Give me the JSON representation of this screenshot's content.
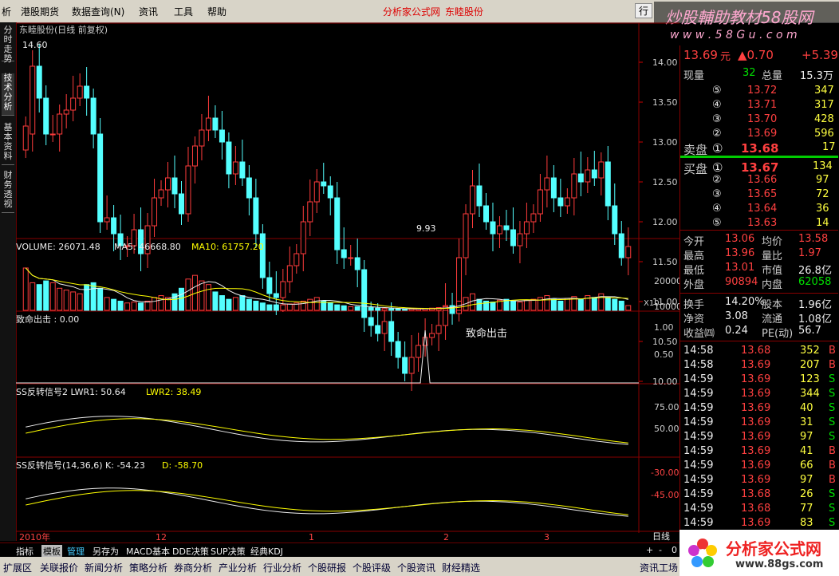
{
  "menu": {
    "items": [
      "析",
      "港股期货",
      "数据查询(N)",
      "资讯",
      "工具",
      "帮助"
    ],
    "center_links": [
      "分析家公式网",
      "东睦股份"
    ],
    "right_btn": "行"
  },
  "watermark": {
    "title": "炒股輔助教材58股网",
    "url": "w w w . 5 8 G u . c o m"
  },
  "vtabs": [
    "分时走势",
    "技术分析",
    "基本资料",
    "财务透视"
  ],
  "chart": {
    "title": "东睦股份(日线 前复权)",
    "price_ticks": [
      "14.00",
      "13.50",
      "13.00",
      "12.50",
      "12.00",
      "11.50",
      "11.00",
      "10.50",
      "10.00"
    ],
    "high_label": "14.60",
    "low_label": "9.93",
    "volume": {
      "label": "VOLUME: 26071.48",
      "ma5": "MA5: 46668.80",
      "ma10": "MA10: 61757.20",
      "ticks": [
        "20000",
        "10000"
      ],
      "unit": "X10"
    },
    "fatal": {
      "label": "致命出击 : 0.00",
      "ticks": [
        "1.00",
        "0.50"
      ],
      "marker": "致命出击"
    },
    "ss2": {
      "label": "SS反转信号2  LWR1: 50.64",
      "lwr2": "LWR2: 38.49",
      "ticks": [
        "75.00",
        "50.00"
      ]
    },
    "ss": {
      "label": "SS反转信号(14,36,6)  K: -54.23",
      "d": "D: -58.70",
      "ticks": [
        "-30.00",
        "-45.00"
      ]
    },
    "xaxis": [
      "2010年",
      "12",
      "1",
      "2",
      "3"
    ],
    "period": "日线"
  },
  "chart_data": {
    "type": "candlestick",
    "title": "东睦股份(日线 前复权)",
    "high": 14.6,
    "low": 9.93,
    "close": [
      13.2,
      13.95,
      13.55,
      13.1,
      13.1,
      13.35,
      13.4,
      13.55,
      13.7,
      13.55,
      13.1,
      12.0,
      12.05,
      11.85,
      11.7,
      11.7,
      11.9,
      11.6,
      11.95,
      12.3,
      12.4,
      12.55,
      12.35,
      12.1,
      12.7,
      12.95,
      13.15,
      13.3,
      13.15,
      13.0,
      12.6,
      12.75,
      12.55,
      12.3,
      11.85,
      11.3,
      11.1,
      11.05,
      11.25,
      11.45,
      11.6,
      12.0,
      12.25,
      12.5,
      12.45,
      12.3,
      11.65,
      11.55,
      11.55,
      11.4,
      10.8,
      10.7,
      10.6,
      10.75,
      10.5,
      10.3,
      10.1,
      10.3,
      10.45,
      10.55,
      10.6,
      10.7,
      10.95,
      10.85,
      11.55,
      12.1,
      12.45,
      12.2,
      12.0,
      11.85,
      11.95,
      11.9,
      11.7,
      11.85,
      12.0,
      12.1,
      12.4,
      12.55,
      12.3,
      12.2,
      12.3,
      12.6,
      12.5,
      12.65,
      12.55,
      12.75,
      12.2,
      11.85,
      11.55,
      11.69
    ],
    "open": [
      12.9,
      13.1,
      13.95,
      13.55,
      13.1,
      13.1,
      13.35,
      13.4,
      13.55,
      13.7,
      13.55,
      13.1,
      12.0,
      12.05,
      11.85,
      11.7,
      11.7,
      11.9,
      11.6,
      11.95,
      12.3,
      12.4,
      12.55,
      12.35,
      12.1,
      12.7,
      12.95,
      13.15,
      13.3,
      13.15,
      13.0,
      12.6,
      12.75,
      12.55,
      12.3,
      11.85,
      11.3,
      11.1,
      11.05,
      11.25,
      11.45,
      11.6,
      12.0,
      12.25,
      12.5,
      12.45,
      12.3,
      11.65,
      11.55,
      11.55,
      11.4,
      10.8,
      10.7,
      10.6,
      10.75,
      10.5,
      10.3,
      10.1,
      10.3,
      10.45,
      10.55,
      10.6,
      10.7,
      10.95,
      10.85,
      11.55,
      12.1,
      12.45,
      12.2,
      12.0,
      11.85,
      11.95,
      11.9,
      11.7,
      11.85,
      12.0,
      12.1,
      12.4,
      12.55,
      12.3,
      12.2,
      12.3,
      12.6,
      12.5,
      12.65,
      12.55,
      12.75,
      12.2,
      11.85,
      11.55
    ],
    "volume": [
      23000,
      15000,
      14000,
      16000,
      15000,
      12000,
      11000,
      10000,
      9000,
      14000,
      15000,
      12000,
      7000,
      6000,
      5000,
      4000,
      4500,
      4000,
      5000,
      7000,
      8000,
      7000,
      9000,
      12000,
      17000,
      19000,
      16000,
      14000,
      10000,
      8000,
      6000,
      7000,
      8000,
      6000,
      5000,
      4000,
      3000,
      3000,
      3000,
      3500,
      4000,
      5000,
      6000,
      7000,
      5000,
      4000,
      3000,
      2500,
      2000,
      2000,
      1800,
      1500,
      1200,
      1000,
      900,
      800,
      700,
      800,
      900,
      1000,
      1200,
      1500,
      2000,
      2500,
      5000,
      7000,
      9000,
      6000,
      5000,
      4500,
      5500,
      6000,
      5000,
      4500,
      5500,
      6000,
      7000,
      8000,
      6000,
      5000,
      6500,
      7500,
      6000,
      8000,
      7000,
      9000,
      7000,
      6000,
      5000,
      2600
    ]
  },
  "panel": {
    "price": "13.69",
    "yuan": "元",
    "chg": "▲0.70",
    "pct": "+5.39",
    "xian_label": "现量",
    "xian": "32",
    "zong_label": "总量",
    "zong": "15.3万",
    "sell": [
      {
        "n": "⑤",
        "p": "13.72",
        "v": "347"
      },
      {
        "n": "④",
        "p": "13.71",
        "v": "317"
      },
      {
        "n": "③",
        "p": "13.70",
        "v": "428"
      },
      {
        "n": "②",
        "p": "13.69",
        "v": "596"
      }
    ],
    "sell1": {
      "lbl": "卖盘",
      "n": "①",
      "p": "13.68",
      "v": "17"
    },
    "buy1": {
      "lbl": "买盘",
      "n": "①",
      "p": "13.67",
      "v": "134"
    },
    "buy": [
      {
        "n": "②",
        "p": "13.66",
        "v": "97"
      },
      {
        "n": "③",
        "p": "13.65",
        "v": "72"
      },
      {
        "n": "④",
        "p": "13.64",
        "v": "36"
      },
      {
        "n": "⑤",
        "p": "13.63",
        "v": "14"
      }
    ],
    "stats1": [
      {
        "a": "今开",
        "av": "13.06",
        "b": "均价",
        "bv": "13.58",
        "ac": "red",
        "bc": "red"
      },
      {
        "a": "最高",
        "av": "13.96",
        "b": "量比",
        "bv": "1.97",
        "ac": "red",
        "bc": "red"
      },
      {
        "a": "最低",
        "av": "13.01",
        "b": "市值",
        "bv": "26.8亿",
        "ac": "red",
        "bc": "wht"
      },
      {
        "a": "外盘",
        "av": "90894",
        "b": "内盘",
        "bv": "62058",
        "ac": "red",
        "bc": "grn"
      }
    ],
    "stats2": [
      {
        "a": "换手",
        "av": "14.20%",
        "b": "股本",
        "bv": "1.96亿"
      },
      {
        "a": "净资",
        "av": "3.08",
        "b": "流通",
        "bv": "1.08亿"
      },
      {
        "a": "收益㈣",
        "av": "0.24",
        "b": "PE(动)",
        "bv": "56.7"
      }
    ],
    "ticks": [
      {
        "t": "14:58",
        "p": "13.68",
        "v": "352",
        "s": "B"
      },
      {
        "t": "14:58",
        "p": "13.69",
        "v": "207",
        "s": "B"
      },
      {
        "t": "14:59",
        "p": "13.69",
        "v": "123",
        "s": "S"
      },
      {
        "t": "14:59",
        "p": "13.69",
        "v": "344",
        "s": "S"
      },
      {
        "t": "14:59",
        "p": "13.69",
        "v": "40",
        "s": "S"
      },
      {
        "t": "14:59",
        "p": "13.69",
        "v": "31",
        "s": "S"
      },
      {
        "t": "14:59",
        "p": "13.69",
        "v": "97",
        "s": "S"
      },
      {
        "t": "14:59",
        "p": "13.69",
        "v": "41",
        "s": "B"
      },
      {
        "t": "14:59",
        "p": "13.69",
        "v": "66",
        "s": "B"
      },
      {
        "t": "14:59",
        "p": "13.69",
        "v": "97",
        "s": "B"
      },
      {
        "t": "14:59",
        "p": "13.68",
        "v": "26",
        "s": "S"
      },
      {
        "t": "14:59",
        "p": "13.68",
        "v": "77",
        "s": "S"
      },
      {
        "t": "14:59",
        "p": "13.69",
        "v": "83",
        "s": "S"
      }
    ]
  },
  "bottom_tabs": [
    "指标",
    "模板",
    "管理",
    "另存为",
    "MACD基本",
    "DDE决策",
    "SUP决策",
    "经典KDJ"
  ],
  "bottom_nav": [
    "扩展区",
    "关联报价",
    "新闻分析",
    "策略分析",
    "券商分析",
    "产业分析",
    "行业分析",
    "个股研报",
    "个股评级",
    "个股资讯",
    "财经精选",
    "资讯工场"
  ],
  "logo": {
    "title": "分析家公式网",
    "url": "www.88gs.com"
  },
  "zoom": [
    "+",
    "-",
    "0"
  ]
}
